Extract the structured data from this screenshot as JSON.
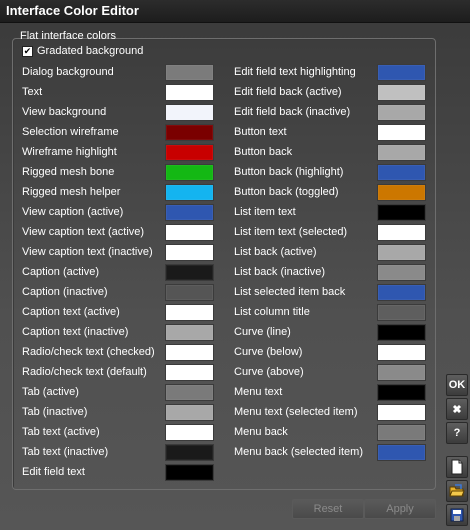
{
  "window": {
    "title": "Interface Color Editor"
  },
  "group": {
    "legend": "Flat interface colors",
    "gradated_label": "Gradated background",
    "gradated_checked": "✔"
  },
  "left_items": [
    {
      "label": "Dialog background",
      "color": "#7b7b7b"
    },
    {
      "label": "Text",
      "color": "#ffffff"
    },
    {
      "label": "View background",
      "color": "#f2f4fb"
    },
    {
      "label": "Selection wireframe",
      "color": "#7a0000"
    },
    {
      "label": "Wireframe highlight",
      "color": "#c80000"
    },
    {
      "label": "Rigged mesh bone",
      "color": "#14b814"
    },
    {
      "label": "Rigged mesh helper",
      "color": "#14b4f0"
    },
    {
      "label": "View caption (active)",
      "color": "#2f57b0"
    },
    {
      "label": "View caption text (active)",
      "color": "#ffffff"
    },
    {
      "label": "View caption text (inactive)",
      "color": "#ffffff"
    },
    {
      "label": "Caption (active)",
      "color": "#1a1a1a"
    },
    {
      "label": "Caption (inactive)",
      "color": "#555555"
    },
    {
      "label": "Caption text (active)",
      "color": "#ffffff"
    },
    {
      "label": "Caption text (inactive)",
      "color": "#a8a8a8"
    },
    {
      "label": "Radio/check text (checked)",
      "color": "#ffffff"
    },
    {
      "label": "Radio/check text (default)",
      "color": "#ffffff"
    },
    {
      "label": "Tab (active)",
      "color": "#7a7a7a"
    },
    {
      "label": "Tab (inactive)",
      "color": "#a8a8a8"
    },
    {
      "label": "Tab text (active)",
      "color": "#ffffff"
    },
    {
      "label": "Tab text (inactive)",
      "color": "#1a1a1a"
    },
    {
      "label": "Edit field text",
      "color": "#000000"
    }
  ],
  "right_items": [
    {
      "label": "Edit field text highlighting",
      "color": "#2f57b0"
    },
    {
      "label": "Edit field back (active)",
      "color": "#c0c0c0"
    },
    {
      "label": "Edit field back (inactive)",
      "color": "#a8a8a8"
    },
    {
      "label": "Button text",
      "color": "#ffffff"
    },
    {
      "label": "Button back",
      "color": "#a8a8a8"
    },
    {
      "label": "Button back (highlight)",
      "color": "#2f57b0"
    },
    {
      "label": "Button back (toggled)",
      "color": "#cc7700"
    },
    {
      "label": "List item text",
      "color": "#000000"
    },
    {
      "label": "List item text (selected)",
      "color": "#ffffff"
    },
    {
      "label": "List back (active)",
      "color": "#a8a8a8"
    },
    {
      "label": "List back (inactive)",
      "color": "#8a8a8a"
    },
    {
      "label": "List selected item back",
      "color": "#2f57b0"
    },
    {
      "label": "List column title",
      "color": "#5e5e5e"
    },
    {
      "label": "Curve (line)",
      "color": "#000000"
    },
    {
      "label": "Curve (below)",
      "color": "#ffffff"
    },
    {
      "label": "Curve (above)",
      "color": "#8a8a8a"
    },
    {
      "label": "Menu text",
      "color": "#000000"
    },
    {
      "label": "Menu text (selected item)",
      "color": "#ffffff"
    },
    {
      "label": "Menu back",
      "color": "#7a7a7a"
    },
    {
      "label": "Menu back (selected item)",
      "color": "#2f57b0"
    }
  ],
  "side_buttons": {
    "ok_label": "OK",
    "close_glyph": "✖",
    "help_glyph": "?"
  },
  "icons": {
    "new": "new-file-icon",
    "open": "open-folder-icon",
    "save": "save-disk-icon"
  },
  "footer": {
    "reset_label": "Reset",
    "apply_label": "Apply"
  }
}
